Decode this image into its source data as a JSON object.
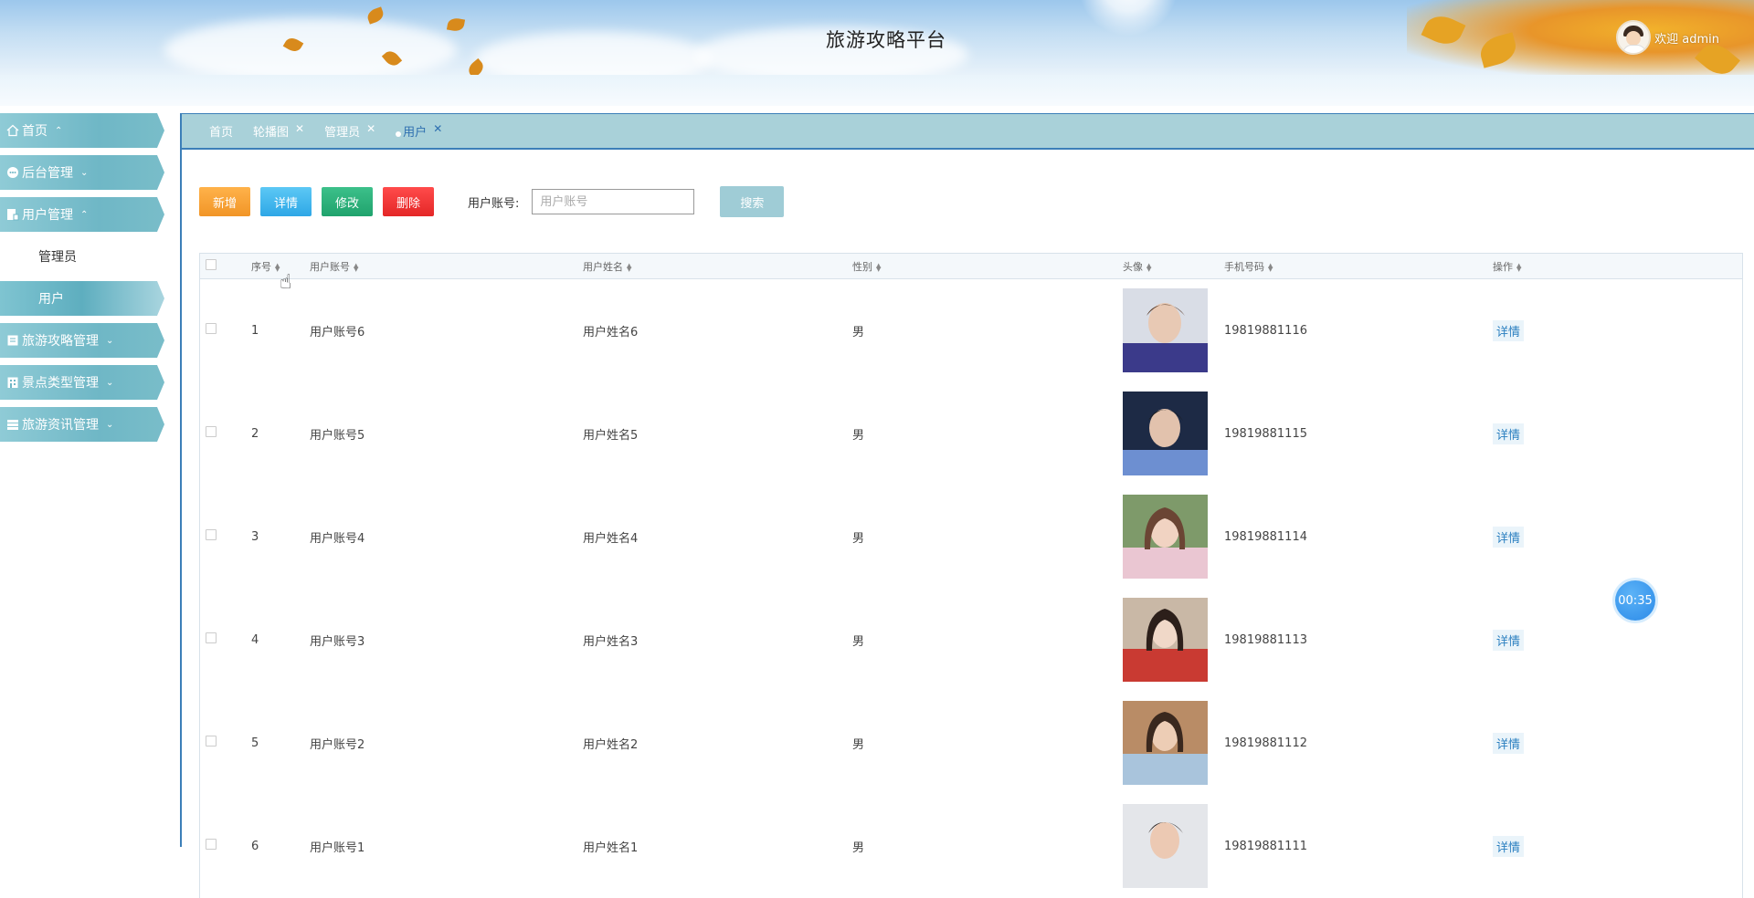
{
  "header": {
    "title": "旅游攻略平台",
    "welcome": "欢迎 admin"
  },
  "sidebar": {
    "items": [
      {
        "label": "首页",
        "icon": "home-icon",
        "chevron": "^"
      },
      {
        "label": "后台管理",
        "icon": "chat-icon",
        "chevron": "v"
      },
      {
        "label": "用户管理",
        "icon": "doc-icon",
        "chevron": "^",
        "children": [
          {
            "label": "管理员"
          },
          {
            "label": "用户",
            "active": true
          }
        ]
      },
      {
        "label": "旅游攻略管理",
        "icon": "book-icon",
        "chevron": "v"
      },
      {
        "label": "景点类型管理",
        "icon": "building-icon",
        "chevron": "v"
      },
      {
        "label": "旅游资讯管理",
        "icon": "list-icon",
        "chevron": "v"
      }
    ]
  },
  "tabs": [
    {
      "label": "首页",
      "closable": false
    },
    {
      "label": "轮播图",
      "closable": true
    },
    {
      "label": "管理员",
      "closable": true
    },
    {
      "label": "用户",
      "closable": true,
      "active": true
    }
  ],
  "toolbar": {
    "add_label": "新增",
    "detail_label": "详情",
    "edit_label": "修改",
    "delete_label": "删除",
    "search_label": "用户账号:",
    "search_placeholder": "用户账号",
    "search_button": "搜索"
  },
  "table": {
    "columns": [
      "序号",
      "用户账号",
      "用户姓名",
      "性别",
      "头像",
      "手机号码",
      "操作"
    ],
    "rows": [
      {
        "index": "1",
        "account": "用户账号6",
        "name": "用户姓名6",
        "gender": "男",
        "phone": "19819881116",
        "action": "详情"
      },
      {
        "index": "2",
        "account": "用户账号5",
        "name": "用户姓名5",
        "gender": "男",
        "phone": "19819881115",
        "action": "详情"
      },
      {
        "index": "3",
        "account": "用户账号4",
        "name": "用户姓名4",
        "gender": "男",
        "phone": "19819881114",
        "action": "详情"
      },
      {
        "index": "4",
        "account": "用户账号3",
        "name": "用户姓名3",
        "gender": "男",
        "phone": "19819881113",
        "action": "详情"
      },
      {
        "index": "5",
        "account": "用户账号2",
        "name": "用户姓名2",
        "gender": "男",
        "phone": "19819881112",
        "action": "详情"
      },
      {
        "index": "6",
        "account": "用户账号1",
        "name": "用户姓名1",
        "gender": "男",
        "phone": "19819881111",
        "action": "详情"
      }
    ]
  },
  "timer": "00:35",
  "colors": {
    "accent": "#3c7fb8",
    "sidebar": "#6fb7c6",
    "tabs_bar": "#a9d1d9",
    "btn_add": "#f19527",
    "btn_detail": "#2ea7e6",
    "btn_edit": "#20a36d",
    "btn_delete": "#e42727",
    "btn_search": "#9fccd6"
  }
}
